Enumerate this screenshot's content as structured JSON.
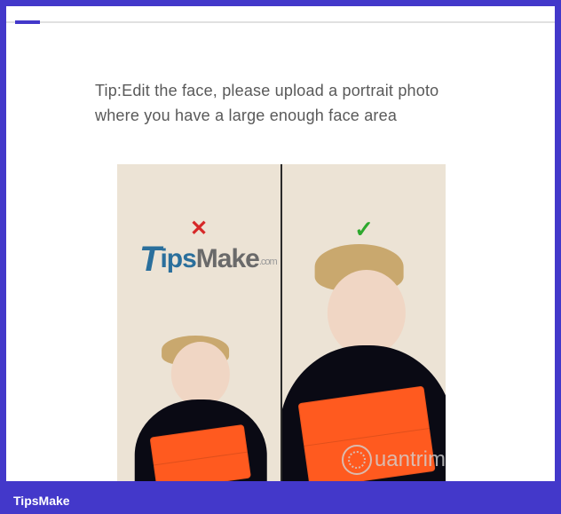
{
  "tip": "Tip:Edit the face, please upload a portrait photo where you have a large enough face area",
  "marks": {
    "bad": "✕",
    "good": "✓"
  },
  "watermarks": {
    "tips_t": "T",
    "tips_rest": "ips",
    "tips_make": "Make",
    "tips_dotcom": ".com",
    "quantri": "uantrimang"
  },
  "footer": "TipsMake"
}
